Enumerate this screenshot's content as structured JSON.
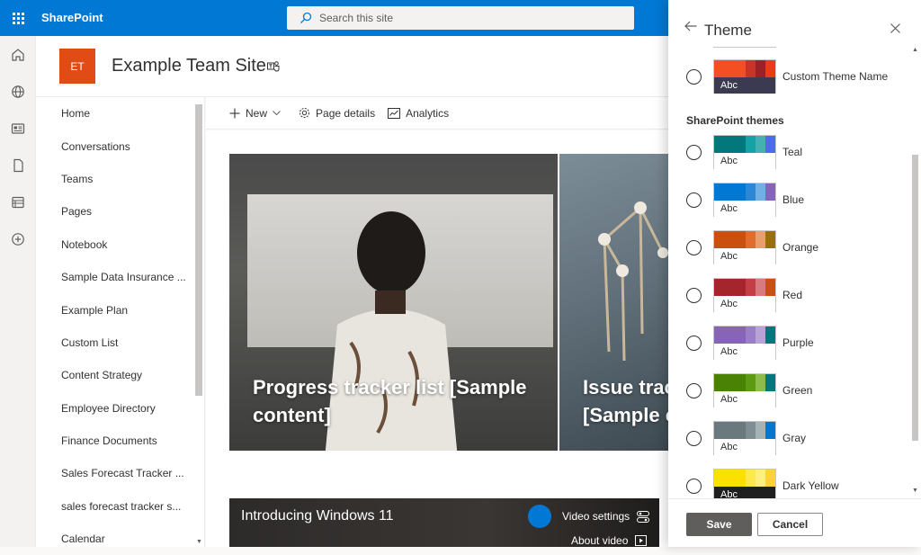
{
  "suite": {
    "brand": "SharePoint",
    "search_placeholder": "Search this site"
  },
  "site": {
    "logo_initials": "ET",
    "title": "Example Team Site"
  },
  "nav": {
    "items": [
      {
        "label": "Home"
      },
      {
        "label": "Conversations"
      },
      {
        "label": "Teams"
      },
      {
        "label": "Pages"
      },
      {
        "label": "Notebook"
      },
      {
        "label": "Sample Data Insurance ..."
      },
      {
        "label": "Example Plan"
      },
      {
        "label": "Custom List"
      },
      {
        "label": "Content Strategy"
      },
      {
        "label": "Employee Directory"
      },
      {
        "label": "Finance Documents"
      },
      {
        "label": "Sales Forecast Tracker ..."
      },
      {
        "label": "sales forecast tracker s..."
      },
      {
        "label": "Calendar"
      }
    ]
  },
  "commandbar": {
    "new_label": "New",
    "page_details_label": "Page details",
    "analytics_label": "Analytics"
  },
  "hero": {
    "tile1_title": "Progress tracker list [Sample content]",
    "tile2_title": "Issue tracker list [Sample content]"
  },
  "video": {
    "title": "Introducing Windows 11",
    "settings_label": "Video settings",
    "about_label": "About video"
  },
  "panel": {
    "title": "Theme",
    "section_label": "SharePoint themes",
    "custom_theme": {
      "name": "Custom Theme Name",
      "abc": "Abc",
      "bands": [
        "#f25022",
        "#ff4b20",
        "#c8342a",
        "#9b2127",
        "#ea3a16"
      ],
      "abc_bg": "#3b3a50",
      "abc_fg": "#ffffff"
    },
    "themes": [
      {
        "name": "Teal",
        "abc": "Abc",
        "bands": [
          "#03787c",
          "#03787c",
          "#13a3a6",
          "#43b0b2",
          "#4f6bed"
        ],
        "abc_bg": "#ffffff",
        "abc_fg": "#323130"
      },
      {
        "name": "Blue",
        "abc": "Abc",
        "bands": [
          "#0078d4",
          "#0078d4",
          "#2b88d8",
          "#71afe5",
          "#8764b8"
        ],
        "abc_bg": "#ffffff",
        "abc_fg": "#323130"
      },
      {
        "name": "Orange",
        "abc": "Abc",
        "bands": [
          "#ca5010",
          "#ca5010",
          "#e06d2d",
          "#e99f6b",
          "#986f0b"
        ],
        "abc_bg": "#ffffff",
        "abc_fg": "#323130"
      },
      {
        "name": "Red",
        "abc": "Abc",
        "bands": [
          "#a4262c",
          "#a4262c",
          "#c43e45",
          "#d87a80",
          "#ca5010"
        ],
        "abc_bg": "#ffffff",
        "abc_fg": "#323130"
      },
      {
        "name": "Purple",
        "abc": "Abc",
        "bands": [
          "#8764b8",
          "#8764b8",
          "#9a7ec6",
          "#b8a3d8",
          "#03787c"
        ],
        "abc_bg": "#ffffff",
        "abc_fg": "#323130"
      },
      {
        "name": "Green",
        "abc": "Abc",
        "bands": [
          "#498205",
          "#498205",
          "#5c9a13",
          "#8cbd4a",
          "#03787c"
        ],
        "abc_bg": "#ffffff",
        "abc_fg": "#323130"
      },
      {
        "name": "Gray",
        "abc": "Abc",
        "bands": [
          "#69797e",
          "#69797e",
          "#7e8e93",
          "#a5b2b6",
          "#0078d4"
        ],
        "abc_bg": "#ffffff",
        "abc_fg": "#323130"
      },
      {
        "name": "Dark Yellow",
        "abc": "Abc",
        "bands": [
          "#fce100",
          "#fce100",
          "#fde94a",
          "#feef7e",
          "#ffd335"
        ],
        "abc_bg": "#1f1f1f",
        "abc_fg": "#ffffff"
      }
    ]
  },
  "buttons": {
    "save": "Save",
    "cancel": "Cancel"
  },
  "colors": {
    "suite_blue": "#0078d4",
    "site_logo": "#e14b16",
    "save_button": "#605e5c"
  }
}
